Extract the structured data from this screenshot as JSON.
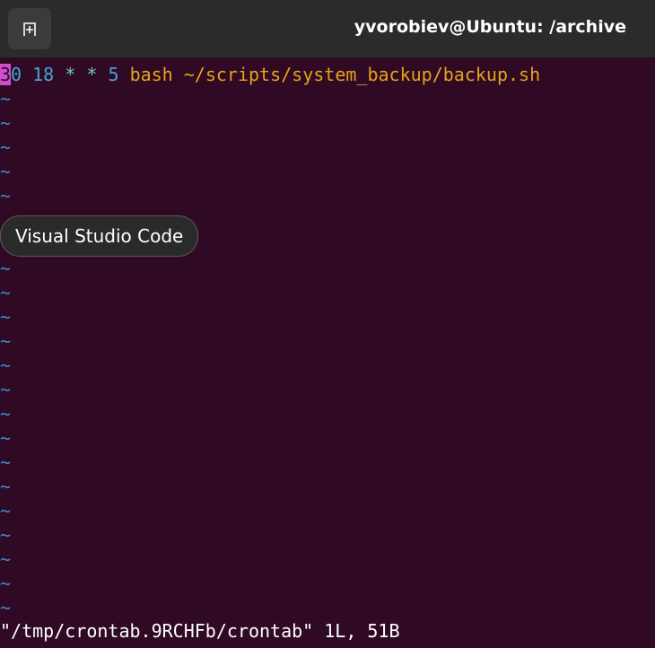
{
  "window": {
    "title": "yvorobiev@Ubuntu: /archive",
    "new_tab_icon": "new-tab-icon"
  },
  "editor": {
    "line1": {
      "cursor_char": "3",
      "minute_rest": "0",
      "hour": "18",
      "star1": "*",
      "star2": "*",
      "weekday": "5",
      "command": "bash ~/scripts/system_backup/backup.sh"
    },
    "empty_line_marker": "~",
    "status": "\"/tmp/crontab.9RCHFb/crontab\" 1L, 51B"
  },
  "tooltip": {
    "label": "Visual Studio Code"
  },
  "colors": {
    "background": "#300a24",
    "cursor": "#d04ecf",
    "number": "#49a4d3",
    "star": "#6fc6c2",
    "command": "#e5a31a",
    "tilde": "#3e89c9"
  }
}
